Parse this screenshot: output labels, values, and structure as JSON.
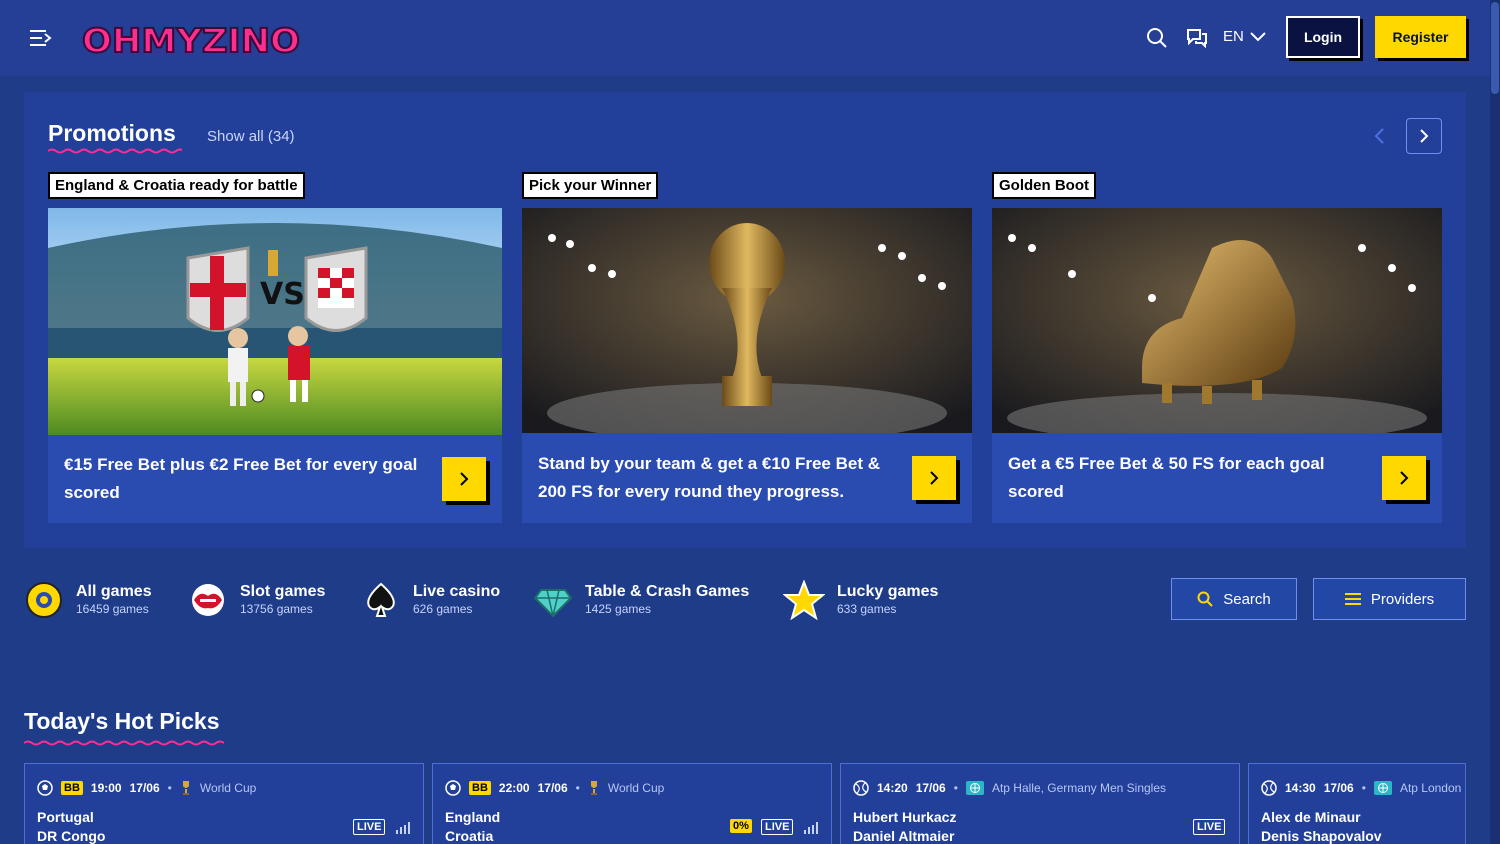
{
  "header": {
    "logo_text": "OHMYZINO",
    "language": "EN",
    "login_label": "Login",
    "register_label": "Register"
  },
  "promotions": {
    "title": "Promotions",
    "show_all": "Show all (34)",
    "cards": [
      {
        "tag": "England & Croatia ready for battle",
        "text": "€15 Free Bet plus €2 Free Bet for every goal scored"
      },
      {
        "tag": "Pick your Winner",
        "text": "Stand by your team & get a €10 Free Bet & 200 FS for every round they progress."
      },
      {
        "tag": "Golden Boot",
        "text": "Get a €5 Free Bet & 50 FS for each goal scored"
      }
    ]
  },
  "categories": [
    {
      "name": "All games",
      "count": "16459 games",
      "icon": "coin-icon"
    },
    {
      "name": "Slot games",
      "count": "13756 games",
      "icon": "lips-icon"
    },
    {
      "name": "Live casino",
      "count": "626 games",
      "icon": "spade-icon"
    },
    {
      "name": "Table & Crash Games",
      "count": "1425 games",
      "icon": "diamond-icon"
    },
    {
      "name": "Lucky games",
      "count": "633 games",
      "icon": "star-icon"
    }
  ],
  "tools": {
    "search_label": "Search",
    "providers_label": "Providers"
  },
  "hot_picks": {
    "title": "Today's Hot Picks",
    "matches": [
      {
        "badge": "BB",
        "time": "19:00",
        "date": "17/06",
        "league": "World Cup",
        "team1": "Portugal",
        "team2": "DR Congo",
        "live": "LIVE"
      },
      {
        "badge": "BB",
        "time": "22:00",
        "date": "17/06",
        "league": "World Cup",
        "team1": "England",
        "team2": "Croatia",
        "boost": "0%",
        "live": "LIVE"
      },
      {
        "time": "14:20",
        "date": "17/06",
        "league": "Atp Halle, Germany Men Singles",
        "team1": "Hubert Hurkacz",
        "team2": "Daniel Altmaier",
        "live": "LIVE"
      },
      {
        "time": "14:30",
        "date": "17/06",
        "league": "Atp London",
        "team1": "Alex de Minaur",
        "team2": "Denis Shapovalov"
      }
    ]
  },
  "colors": {
    "background": "#1f3c88",
    "accent": "#ffd800",
    "brand_pink": "#ff2e8e"
  }
}
